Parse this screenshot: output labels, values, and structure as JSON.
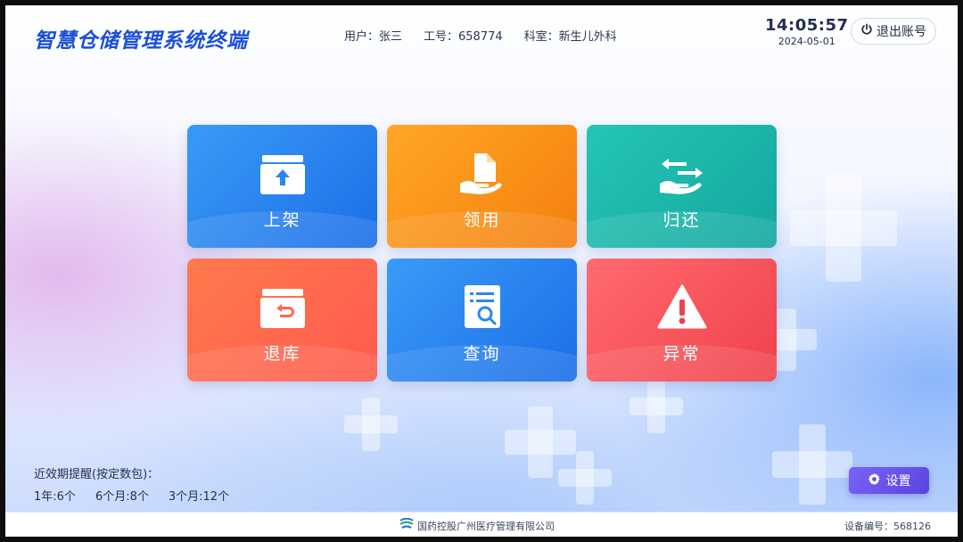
{
  "header": {
    "app_title": "智慧仓储管理系统终端",
    "user": "用户：张三",
    "employee_id": "工号：658774",
    "department": "科室：新生儿外科",
    "time": "14:05:57",
    "date": "2024-05-01",
    "logout_label": "退出账号",
    "logout_icon": "power-icon"
  },
  "tiles": [
    {
      "label": "上架",
      "icon": "box-upload-icon",
      "color": "#1b6ee8"
    },
    {
      "label": "领用",
      "icon": "hand-document-icon",
      "color": "#f57f0e"
    },
    {
      "label": "归还",
      "icon": "hand-return-icon",
      "color": "#13a79f"
    },
    {
      "label": "退库",
      "icon": "box-return-icon",
      "color": "#ff5a4e"
    },
    {
      "label": "查询",
      "icon": "document-search-icon",
      "color": "#1b6ee8"
    },
    {
      "label": "异常",
      "icon": "warning-icon",
      "color": "#f0414b"
    }
  ],
  "expiry": {
    "title": "近效期提醒(按定数包)：",
    "items": [
      "1年:6个",
      "6个月:8个",
      "3个月:12个"
    ]
  },
  "settings": {
    "label": "设置",
    "icon": "gear-icon",
    "color": "#6a52ea"
  },
  "footer": {
    "company": "国药控股广州医疗管理有限公司",
    "device": "设备编号：568126"
  }
}
